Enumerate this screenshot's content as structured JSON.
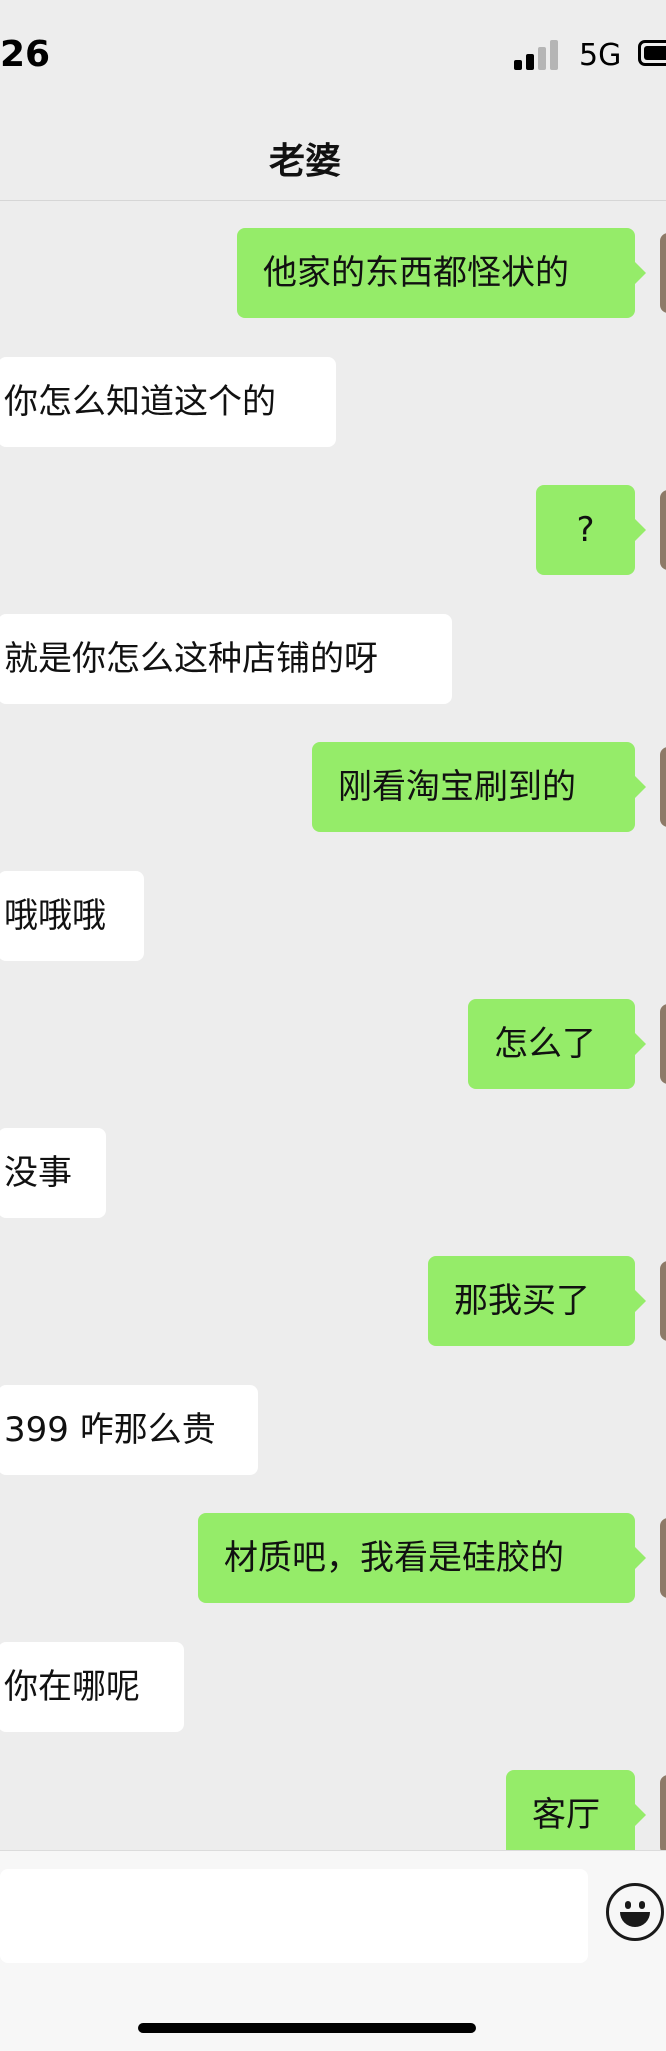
{
  "status_bar": {
    "time": "26",
    "network": "5G"
  },
  "header": {
    "title": "老婆"
  },
  "messages": [
    {
      "side": "right",
      "text": "他家的东西都怪状的"
    },
    {
      "side": "left",
      "text": "你怎么知道这个的"
    },
    {
      "side": "right",
      "text": "?"
    },
    {
      "side": "left",
      "text": "就是你怎么这种店铺的呀"
    },
    {
      "side": "right",
      "text": "刚看淘宝刷到的"
    },
    {
      "side": "left",
      "text": "哦哦哦"
    },
    {
      "side": "right",
      "text": "怎么了"
    },
    {
      "side": "left",
      "text": "没事"
    },
    {
      "side": "right",
      "text": "那我买了"
    },
    {
      "side": "left",
      "text": "399 咋那么贵"
    },
    {
      "side": "right",
      "text": "材质吧，我看是硅胶的"
    },
    {
      "side": "left",
      "text": "你在哪呢"
    },
    {
      "side": "right",
      "text": "客厅"
    }
  ],
  "input": {
    "value": "",
    "placeholder": ""
  },
  "icons": {
    "emoji": "smiley-icon",
    "signal": "signal-icon",
    "battery": "battery-icon"
  },
  "colors": {
    "outgoing_bubble": "#95ec69",
    "incoming_bubble": "#ffffff",
    "background": "#ededed"
  }
}
